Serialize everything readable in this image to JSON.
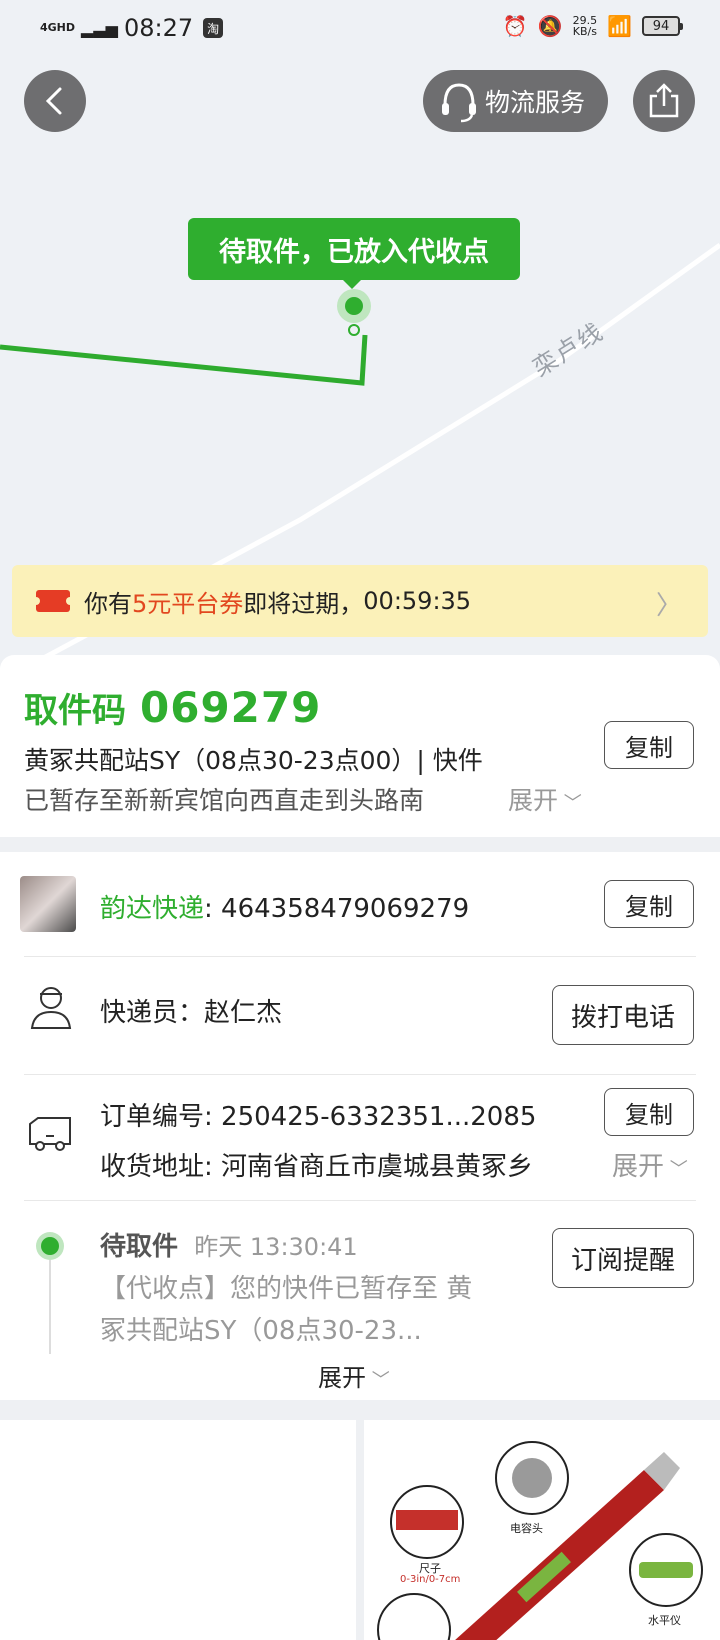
{
  "status_bar": {
    "signal": "4GHD",
    "time": "08:27",
    "app_badge": "淘",
    "speed_value": "29.5",
    "speed_unit": "KB/s",
    "battery": "94"
  },
  "top_bar": {
    "logistics_service": "物流服务"
  },
  "map": {
    "bubble": "待取件，已放入代收点",
    "road_label": "栾卢线"
  },
  "coupon": {
    "prefix": "你有",
    "highlight": "5元平台券",
    "suffix": "即将过期，",
    "countdown": "00:59:35"
  },
  "pickup_card": {
    "label": "取件码",
    "code": "069279",
    "station": "黄冢共配站SY（08点30-23点00）| 快件",
    "detail": "已暂存至新新宾馆向西直走到头路南",
    "expand": "展开",
    "copy_label": "复制"
  },
  "shipment": {
    "carrier": "韵达快递",
    "tracking_number": ": 464358479069279",
    "copy_label": "复制",
    "courier_label": "快递员：",
    "courier_name": "赵仁杰",
    "call_label": "拨打电话",
    "order_label": "订单编号: ",
    "order_number": "250425-6332351...2085",
    "order_copy": "复制",
    "address_label": "收货地址: ",
    "address": "河南省商丘市虞城县黄冢乡",
    "address_expand": "展开",
    "event_status": "待取件",
    "event_time": "昨天 13:30:41",
    "event_line1": "【代收点】您的快件已暂存至 黄",
    "event_line2": "冢共配站SY（08点30-23...",
    "subscribe_label": "订阅提醒",
    "timeline_expand": "展开"
  },
  "product": {
    "label_cap": "电容头",
    "label_ruler": "尺子",
    "label_ruler_size": "0-3in/0-7cm",
    "label_level": "水平仪"
  },
  "colors": {
    "accent_green": "#2fae2f",
    "coupon_red": "#e2471f",
    "coupon_bg": "#fbf1b9"
  }
}
